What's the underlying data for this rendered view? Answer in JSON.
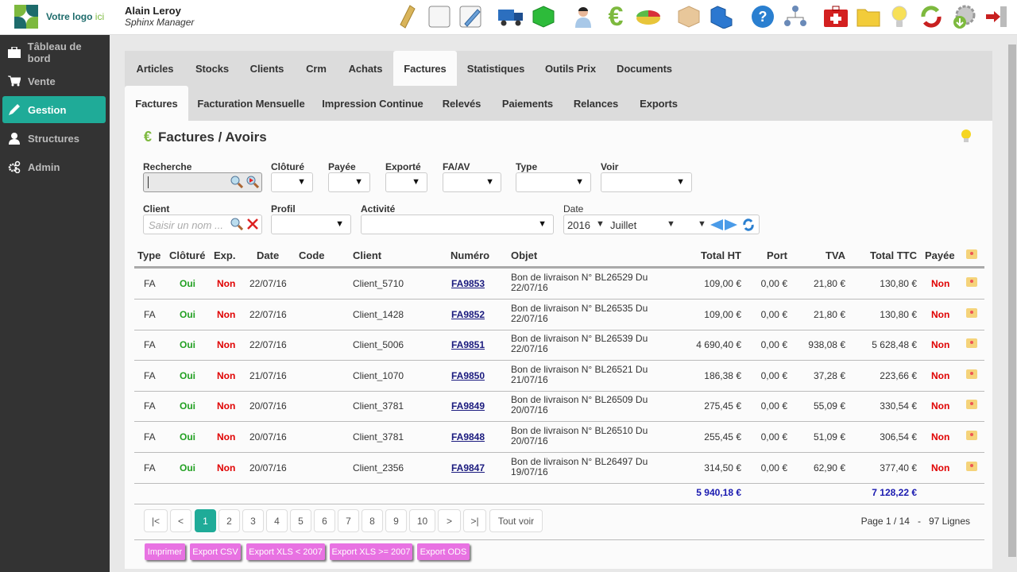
{
  "header": {
    "logo_text": "Votre logo",
    "logo_suffix": "ici",
    "user_name": "Alain Leroy",
    "user_role": "Sphinx Manager",
    "tools": [
      "scroll-icon",
      "blank-page-icon",
      "edit-page-icon",
      "delivery-truck-icon",
      "green-box-icon",
      "user-icon",
      "euro-icon",
      "pie-chart-icon",
      "cardboard-box-icon",
      "blue-boxes-icon",
      "help-icon",
      "org-chart-icon",
      "first-aid-kit-icon",
      "folder-icon",
      "lightbulb-icon",
      "refresh-icon",
      "settings-download-icon",
      "logout-icon"
    ]
  },
  "sidebar": {
    "items": [
      {
        "label": "Tâbleau de bord",
        "icon": "briefcase-icon"
      },
      {
        "label": "Vente",
        "icon": "cart-icon"
      },
      {
        "label": "Gestion",
        "icon": "pencil-icon",
        "active": true
      },
      {
        "label": "Structures",
        "icon": "person-icon"
      },
      {
        "label": "Admin",
        "icon": "gears-icon"
      }
    ]
  },
  "tabs": {
    "main": [
      "Articles",
      "Stocks",
      "Clients",
      "Crm",
      "Achats",
      "Factures",
      "Statistiques",
      "Outils Prix",
      "Documents"
    ],
    "main_active": "Factures",
    "sub": [
      "Factures",
      "Facturation Mensuelle",
      "Impression Continue",
      "Relevés",
      "Paiements",
      "Relances",
      "Exports"
    ],
    "sub_active": "Factures"
  },
  "page": {
    "title": "Factures / Avoirs"
  },
  "filters": {
    "recherche_label": "Recherche",
    "recherche_value": "",
    "cloture_label": "Clôturé",
    "payee_label": "Payée",
    "exporte_label": "Exporté",
    "faav_label": "FA/AV",
    "type_label": "Type",
    "voir_label": "Voir",
    "client_label": "Client",
    "client_placeholder": "Saisir un nom ...",
    "profil_label": "Profil",
    "activite_label": "Activité",
    "date_label": "Date",
    "date_year": "2016",
    "date_month": "Juillet"
  },
  "table": {
    "headers": {
      "type": "Type",
      "cloture": "Clôturé",
      "exp": "Exp.",
      "date": "Date",
      "code": "Code",
      "client": "Client",
      "numero": "Numéro",
      "objet": "Objet",
      "total_ht": "Total HT",
      "port": "Port",
      "tva": "TVA",
      "total_ttc": "Total TTC",
      "payee": "Payée"
    },
    "rows": [
      {
        "type": "FA",
        "cloture": "Oui",
        "exp": "Non",
        "date": "22/07/16",
        "code": "",
        "client": "Client_5710",
        "numero": "FA9853",
        "objet1": "Bon de livraison N° BL26529 Du",
        "objet2": "22/07/16",
        "total_ht": "109,00 €",
        "port": "0,00 €",
        "tva": "21,80 €",
        "total_ttc": "130,80 €",
        "payee": "Non"
      },
      {
        "type": "FA",
        "cloture": "Oui",
        "exp": "Non",
        "date": "22/07/16",
        "code": "",
        "client": "Client_1428",
        "numero": "FA9852",
        "objet1": "Bon de livraison N° BL26535 Du",
        "objet2": "22/07/16",
        "total_ht": "109,00 €",
        "port": "0,00 €",
        "tva": "21,80 €",
        "total_ttc": "130,80 €",
        "payee": "Non"
      },
      {
        "type": "FA",
        "cloture": "Oui",
        "exp": "Non",
        "date": "22/07/16",
        "code": "",
        "client": "Client_5006",
        "numero": "FA9851",
        "objet1": "Bon de livraison N° BL26539 Du",
        "objet2": "22/07/16",
        "total_ht": "4 690,40 €",
        "port": "0,00 €",
        "tva": "938,08 €",
        "total_ttc": "5 628,48 €",
        "payee": "Non"
      },
      {
        "type": "FA",
        "cloture": "Oui",
        "exp": "Non",
        "date": "21/07/16",
        "code": "",
        "client": "Client_1070",
        "numero": "FA9850",
        "objet1": "Bon de livraison N° BL26521 Du",
        "objet2": "21/07/16",
        "total_ht": "186,38 €",
        "port": "0,00 €",
        "tva": "37,28 €",
        "total_ttc": "223,66 €",
        "payee": "Non"
      },
      {
        "type": "FA",
        "cloture": "Oui",
        "exp": "Non",
        "date": "20/07/16",
        "code": "",
        "client": "Client_3781",
        "numero": "FA9849",
        "objet1": "Bon de livraison N° BL26509 Du",
        "objet2": "20/07/16",
        "total_ht": "275,45 €",
        "port": "0,00 €",
        "tva": "55,09 €",
        "total_ttc": "330,54 €",
        "payee": "Non"
      },
      {
        "type": "FA",
        "cloture": "Oui",
        "exp": "Non",
        "date": "20/07/16",
        "code": "",
        "client": "Client_3781",
        "numero": "FA9848",
        "objet1": "Bon de livraison N° BL26510 Du",
        "objet2": "20/07/16",
        "total_ht": "255,45 €",
        "port": "0,00 €",
        "tva": "51,09 €",
        "total_ttc": "306,54 €",
        "payee": "Non"
      },
      {
        "type": "FA",
        "cloture": "Oui",
        "exp": "Non",
        "date": "20/07/16",
        "code": "",
        "client": "Client_2356",
        "numero": "FA9847",
        "objet1": "Bon de livraison N° BL26497 Du",
        "objet2": "19/07/16",
        "total_ht": "314,50 €",
        "port": "0,00 €",
        "tva": "62,90 €",
        "total_ttc": "377,40 €",
        "payee": "Non"
      }
    ],
    "total_ht": "5 940,18 €",
    "total_ttc": "7 128,22 €"
  },
  "pagination": {
    "first": "|<",
    "prev": "<",
    "pages": [
      "1",
      "2",
      "3",
      "4",
      "5",
      "6",
      "7",
      "8",
      "9",
      "10"
    ],
    "current": "1",
    "next": ">",
    "last": ">|",
    "all": "Tout voir",
    "info": "Page 1 / 14   -   97 Lignes"
  },
  "exports": [
    "Imprimer",
    "Export CSV",
    "Export XLS < 2007",
    "Export XLS >= 2007",
    "Export ODS"
  ],
  "colors": {
    "accent": "#1fab98",
    "oui": "#22a022",
    "non": "#e00000",
    "link": "#1a1a7e",
    "export": "#e872e2"
  }
}
